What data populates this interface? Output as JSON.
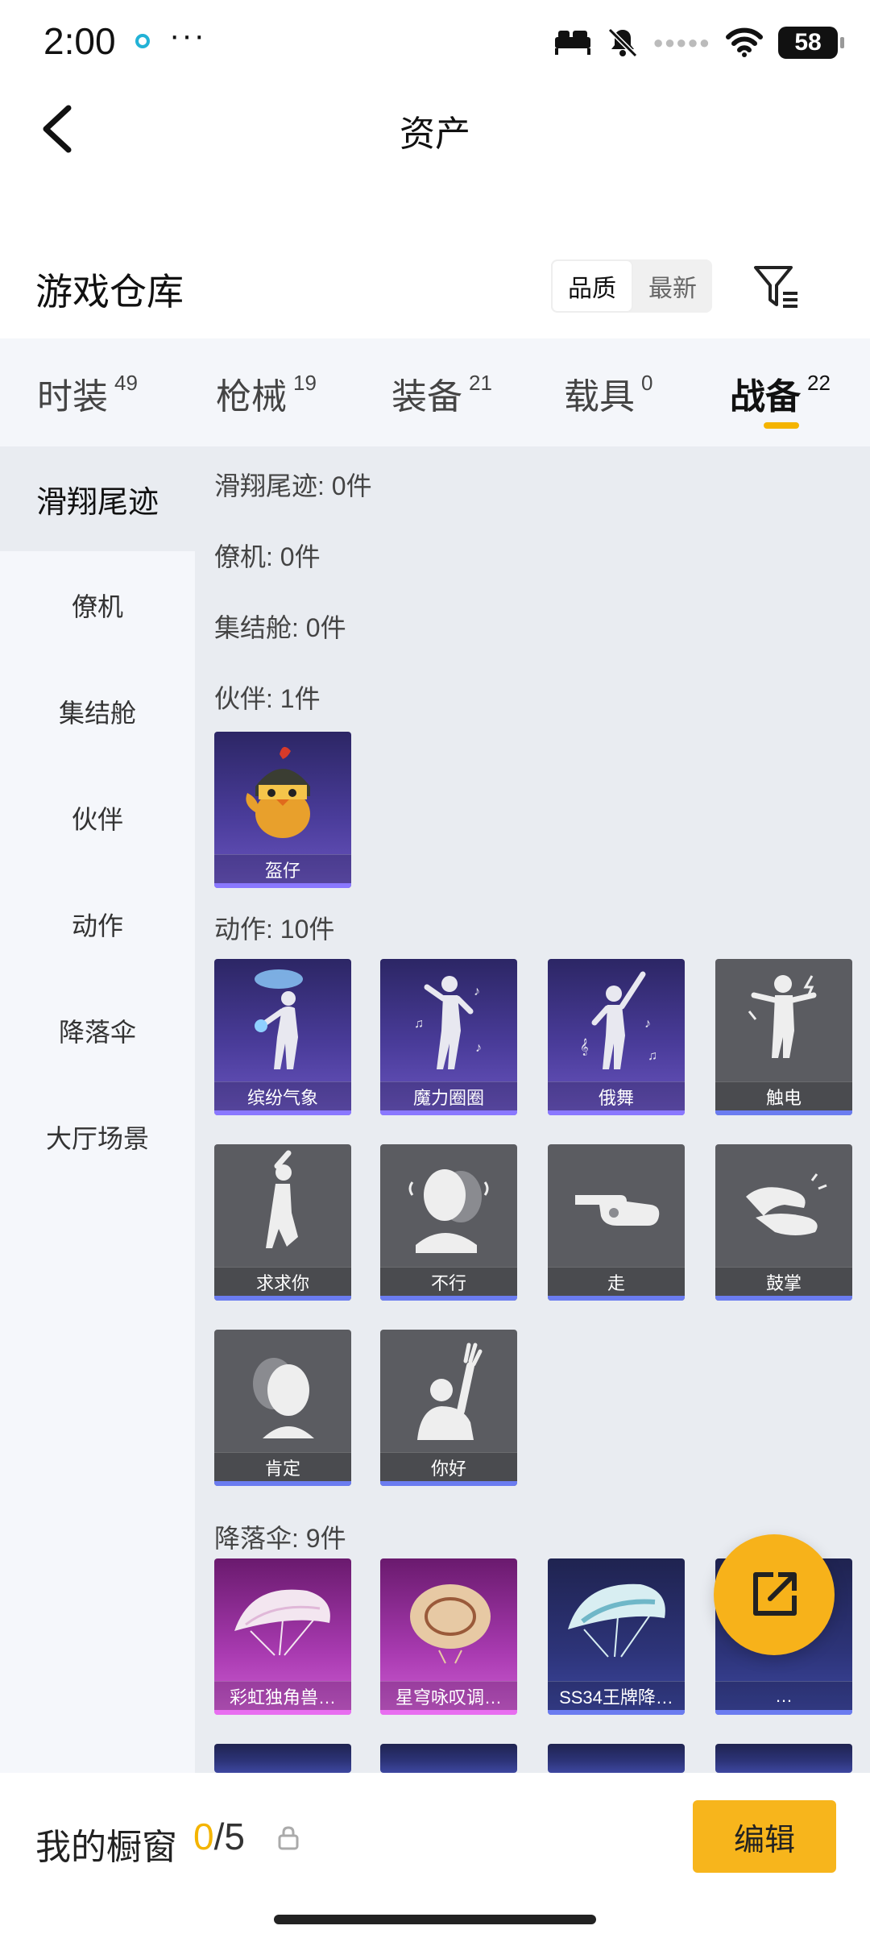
{
  "status_bar": {
    "time": "2:00",
    "more": "···",
    "battery": "58"
  },
  "header": {
    "title": "资产"
  },
  "warehouse": {
    "title": "游戏仓库",
    "sort_options": [
      "品质",
      "最新"
    ]
  },
  "tabs": [
    {
      "label": "时装",
      "count": "49"
    },
    {
      "label": "枪械",
      "count": "19"
    },
    {
      "label": "装备",
      "count": "21"
    },
    {
      "label": "载具",
      "count": "0"
    },
    {
      "label": "战备",
      "count": "22"
    }
  ],
  "sidebar": {
    "items": [
      "滑翔尾迹",
      "僚机",
      "集结舱",
      "伙伴",
      "动作",
      "降落伞",
      "大厅场景"
    ]
  },
  "sections": {
    "glide": "滑翔尾迹: 0件",
    "wingman": "僚机: 0件",
    "pod": "集结舱: 0件",
    "partner": "伙伴: 1件",
    "emote": "动作: 10件",
    "parachute": "降落伞: 9件"
  },
  "partner_items": [
    "盔仔"
  ],
  "emote_items": [
    "缤纷气象",
    "魔力圈圈",
    "俄舞",
    "触电",
    "求求你",
    "不行",
    "走",
    "鼓掌",
    "肯定",
    "你好"
  ],
  "parachute_items": [
    "彩虹独角兽…",
    "星穹咏叹调…",
    "SS34王牌降…",
    "…"
  ],
  "bottom": {
    "showcase_label": "我的橱窗",
    "current": "0",
    "total": "/5",
    "edit": "编辑"
  },
  "colors": {
    "accent": "#f7b21a",
    "card_gray": "#5b5c61",
    "card_purple": "#4a3c9a",
    "card_pink": "#a83ab0"
  }
}
